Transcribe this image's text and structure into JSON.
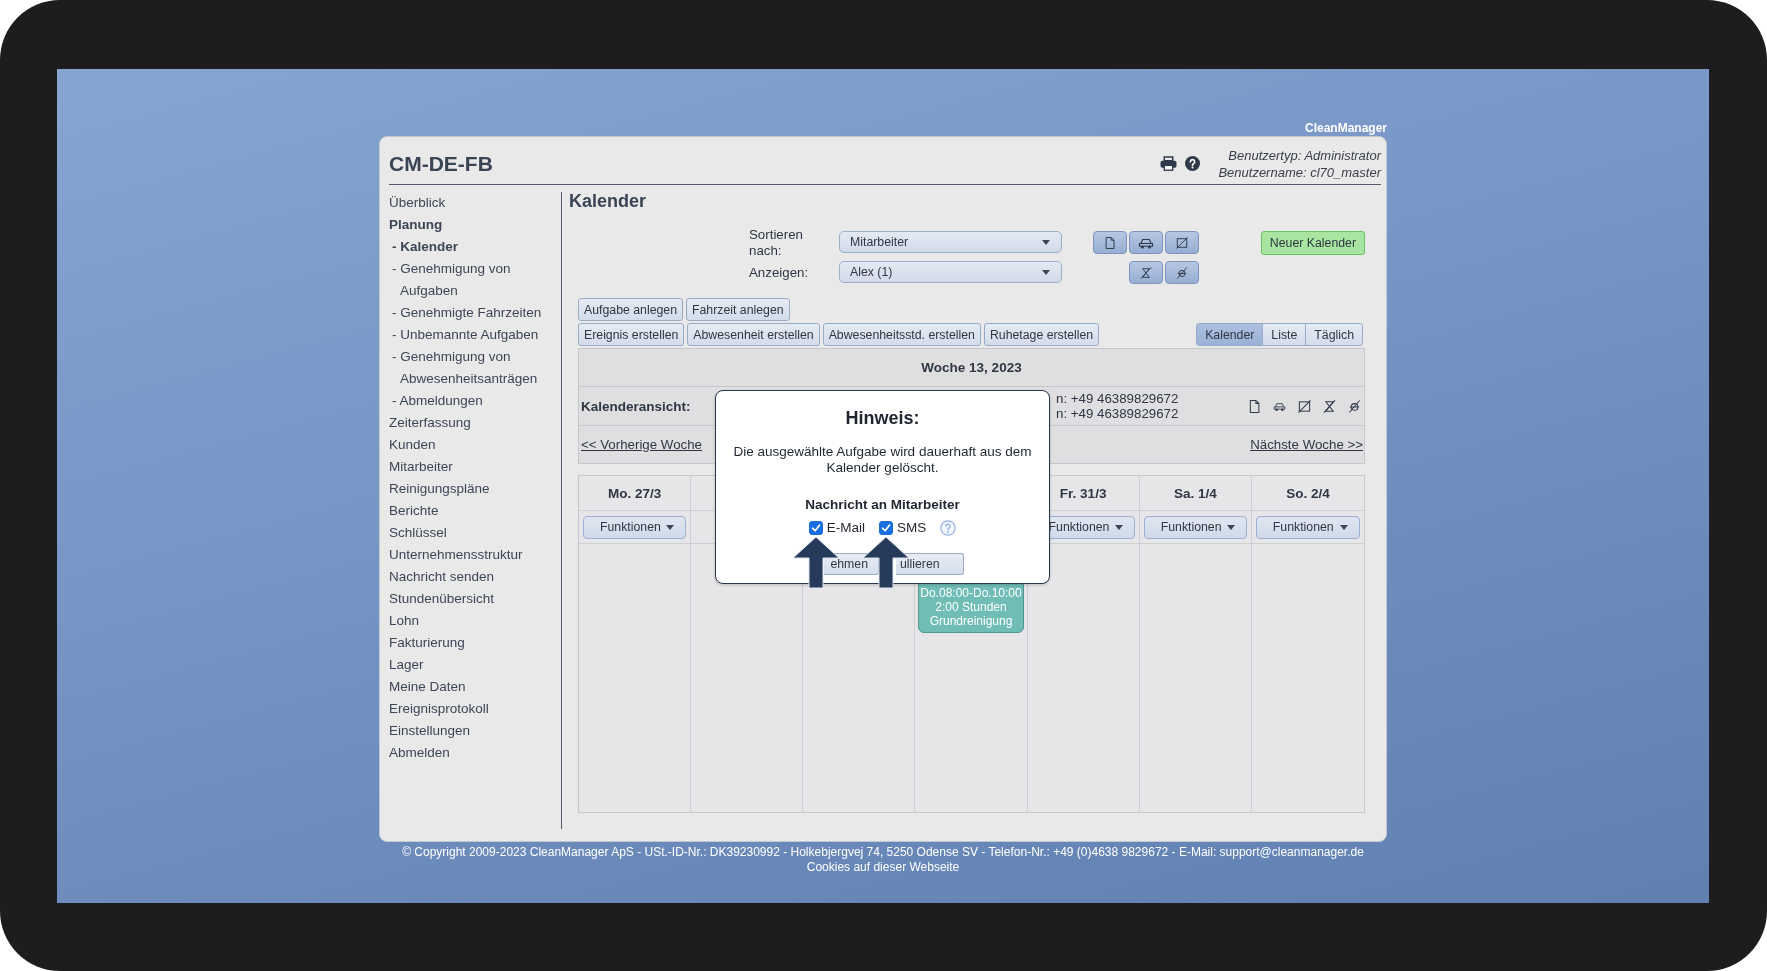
{
  "brand": "CleanManager",
  "app": {
    "title": "CM-DE-FB",
    "user_type": "Benutzertyp: Administrator",
    "user_name": "Benutzername: cl70_master"
  },
  "sidebar": {
    "items": [
      {
        "label": "Überblick",
        "selected": false
      },
      {
        "label": "Planung",
        "selected": true,
        "children": [
          {
            "label": "- Kalender",
            "selected": true
          },
          {
            "label": "- Genehmigung von Aufgaben",
            "selected": false
          },
          {
            "label": "- Genehmigte Fahrzeiten",
            "selected": false
          },
          {
            "label": "- Unbemannte Aufgaben",
            "selected": false
          },
          {
            "label": "- Genehmigung von Abwesenheitsanträgen",
            "selected": false
          },
          {
            "label": "- Abmeldungen",
            "selected": false
          }
        ]
      },
      {
        "label": "Zeiterfassung",
        "selected": false
      },
      {
        "label": "Kunden",
        "selected": false
      },
      {
        "label": "Mitarbeiter",
        "selected": false
      },
      {
        "label": "Reinigungspläne",
        "selected": false
      },
      {
        "label": "Berichte",
        "selected": false
      },
      {
        "label": "Schlüssel",
        "selected": false
      },
      {
        "label": "Unternehmensstruktur",
        "selected": false
      },
      {
        "label": "Nachricht senden",
        "selected": false
      },
      {
        "label": "Stundenübersicht",
        "selected": false
      },
      {
        "label": "Lohn",
        "selected": false
      },
      {
        "label": "Fakturierung",
        "selected": false
      },
      {
        "label": "Lager",
        "selected": false
      },
      {
        "label": "Meine Daten",
        "selected": false
      },
      {
        "label": "Ereignisprotokoll",
        "selected": false
      },
      {
        "label": "Einstellungen",
        "selected": false
      },
      {
        "label": "Abmelden",
        "selected": false
      }
    ]
  },
  "page": {
    "heading": "Kalender",
    "filters": [
      {
        "label": "Sortieren nach:",
        "value": "Mitarbeiter"
      },
      {
        "label": "Anzeigen:",
        "value": "Alex (1)"
      }
    ],
    "new_button": "Neuer Kalender",
    "action_rows": [
      [
        "Aufgabe anlegen",
        "Fahrzeit anlegen"
      ],
      [
        "Ereignis erstellen",
        "Abwesenheit erstellen",
        "Abwesenheitsstd. erstellen",
        "Ruhetage erstellen"
      ]
    ],
    "views": [
      {
        "label": "Kalender",
        "selected": true
      },
      {
        "label": "Liste",
        "selected": false
      },
      {
        "label": "Täglich",
        "selected": false
      }
    ]
  },
  "calendar": {
    "week": "Woche 13, 2023",
    "view_label": "Kalenderansicht:",
    "contact_lines": [
      "n: +49 46389829672",
      "n: +49 46389829672"
    ],
    "prev_link": "<< Vorherige Woche",
    "next_link": "Nächste Woche >>",
    "days": [
      {
        "kind": "day",
        "label": "Mo. 27/3",
        "button": "Funktionen"
      },
      {
        "kind": "covered"
      },
      {
        "kind": "covered"
      },
      {
        "kind": "covered",
        "events": [
          {
            "time": "Do.08:00-Do.10:00",
            "duration": "2:00 Stunden",
            "title": "Grundreinigung"
          }
        ]
      },
      {
        "kind": "day",
        "label": "Fr. 31/3",
        "button": "Funktionen"
      },
      {
        "kind": "day",
        "label": "Sa. 1/4",
        "button": "Funktionen"
      },
      {
        "kind": "day",
        "label": "So. 2/4",
        "button": "Funktionen"
      }
    ]
  },
  "dialog": {
    "title": "Hinweis:",
    "message": "Die ausgewählte Aufgabe wird dauerhaft aus dem Kalender gelöscht.",
    "section": "Nachricht an Mitarbeiter",
    "options": [
      {
        "label": "E-Mail",
        "checked": true,
        "marked_by_arrow": true
      },
      {
        "label": "SMS",
        "checked": true,
        "marked_by_arrow": true
      }
    ],
    "buttons": [
      "ehmen",
      "ullieren"
    ]
  },
  "footer": {
    "copyright": "© Copyright 2009-2023 CleanManager ApS - USt.-ID-Nr.: DK39230992 - Holkebjergvej 74, 5250 Odense SV - Telefon-Nr.: +49 (0)4638 9829672 - E-Mail: support@cleanmanager.de",
    "cookies_link": "Cookies auf dieser Webseite"
  }
}
